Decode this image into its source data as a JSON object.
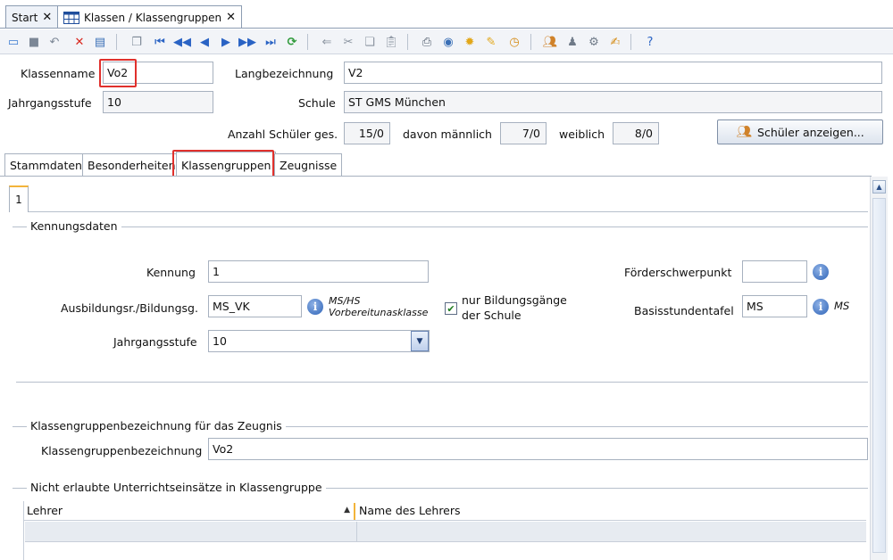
{
  "doc_tabs": {
    "start_label": "Start",
    "active_label": "Klassen / Klassengruppen",
    "close_glyph": "✕"
  },
  "toolbar": {
    "icons": [
      "new-record-icon",
      "save-icon",
      "save-all-icon",
      "undo-icon",
      "delete-icon",
      "print-preview-icon",
      "copy-record-icon",
      "first-record-icon",
      "previous-page-icon",
      "previous-record-icon",
      "next-record-icon",
      "next-page-icon",
      "last-record-icon",
      "refresh-icon",
      "back-icon",
      "cut-icon",
      "copy-icon",
      "paste-icon",
      "print-icon",
      "preview-icon",
      "hint-icon",
      "clean-icon",
      "timer-icon",
      "users-icon",
      "group-icon",
      "settings-icon",
      "edit-icon",
      "help-icon"
    ]
  },
  "header": {
    "klassenname_label": "Klassenname",
    "klassenname_value": "Vo2",
    "langbezeichnung_label": "Langbezeichnung",
    "langbezeichnung_value": "V2",
    "jahrgangsstufe_label": "Jahrgangsstufe",
    "jahrgangsstufe_value": "10",
    "schule_label": "Schule",
    "schule_value": "ST GMS München",
    "anzahl_label": "Anzahl Schüler ges.",
    "anzahl_value": "15/0",
    "maennlich_label": "davon männlich",
    "maennlich_value": "7/0",
    "weiblich_label": "weiblich",
    "weiblich_value": "8/0",
    "schueler_button": "Schüler anzeigen..."
  },
  "sub_tabs": [
    "Stammdaten",
    "Besonderheiten",
    "Klassengruppen",
    "Zeugnisse"
  ],
  "inner_tab": "1",
  "kennungsdaten": {
    "title": "Kennungsdaten",
    "kennung_label": "Kennung",
    "kennung_value": "1",
    "ausbildung_label": "Ausbildungsr./Bildungsg.",
    "ausbildung_value": "MS_VK",
    "ausbildung_note_line1": "MS/HS",
    "ausbildung_note_line2": "Vorbereitunasklasse",
    "nur_bildungsgaenge_line1": "nur Bildungsgänge",
    "nur_bildungsgaenge_line2": "der Schule",
    "nur_bildungsgaenge_checked": true,
    "jahrgangsstufe_label": "Jahrgangsstufe",
    "jahrgangsstufe_value": "10",
    "foerderschwerpunkt_label": "Förderschwerpunkt",
    "foerderschwerpunkt_value": "",
    "basisstundentafel_label": "Basisstundentafel",
    "basisstundentafel_value": "MS",
    "basisstundentafel_note": "MS"
  },
  "zeugnis": {
    "title": "Klassengruppenbezeichnung für das Zeugnis",
    "label": "Klassengruppenbezeichnung",
    "value": "Vo2"
  },
  "unterricht": {
    "title": "Nicht erlaubte Unterrichtseinsätze in Klassengruppe",
    "columns": [
      "Lehrer",
      "Name des Lehrers"
    ]
  },
  "colors": {
    "highlight_red": "#e0302c",
    "accent_orange": "#f3b43a"
  }
}
